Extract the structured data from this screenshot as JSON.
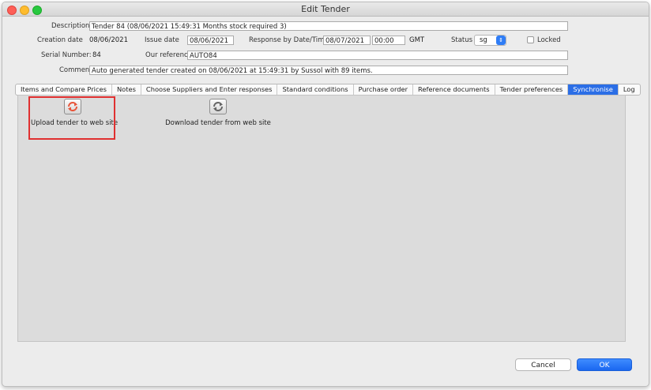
{
  "window": {
    "title": "Edit Tender"
  },
  "form": {
    "description_label": "Description",
    "description_value": "Tender 84 (08/06/2021 15:49:31 Months stock required 3)",
    "creation_date_label": "Creation date",
    "creation_date_value": "08/06/2021",
    "issue_date_label": "Issue date",
    "issue_date_value": "08/06/2021",
    "response_label": "Response by Date/Time",
    "response_date_value": "08/07/2021",
    "response_time_value": "00:00",
    "timezone": "GMT",
    "status_label": "Status",
    "status_value": "sg",
    "locked_label": "Locked",
    "serial_label": "Serial Number:",
    "serial_value": "84",
    "our_reference_label": "Our reference",
    "our_reference_value": "AUTO84",
    "comment_label": "Comment",
    "comment_value": "Auto generated tender created on 08/06/2021 at 15:49:31 by Sussol with 89 items."
  },
  "tabs": [
    {
      "label": "Items and Compare Prices"
    },
    {
      "label": "Notes"
    },
    {
      "label": "Choose Suppliers and Enter responses"
    },
    {
      "label": "Standard conditions"
    },
    {
      "label": "Purchase order"
    },
    {
      "label": "Reference documents"
    },
    {
      "label": "Tender preferences"
    },
    {
      "label": "Synchronise",
      "active": true
    },
    {
      "label": "Log"
    }
  ],
  "actions": {
    "upload_label": "Upload tender to web site",
    "upload_icon": "sync-upload-icon",
    "download_label": "Download tender from web site",
    "download_icon": "sync-download-icon"
  },
  "buttons": {
    "cancel": "Cancel",
    "ok": "OK"
  },
  "colors": {
    "active_tab": "#2b6ee6",
    "ok_button": "#1a67f0",
    "highlight": "#e03030",
    "upload_icon_color": "#e8553a"
  }
}
